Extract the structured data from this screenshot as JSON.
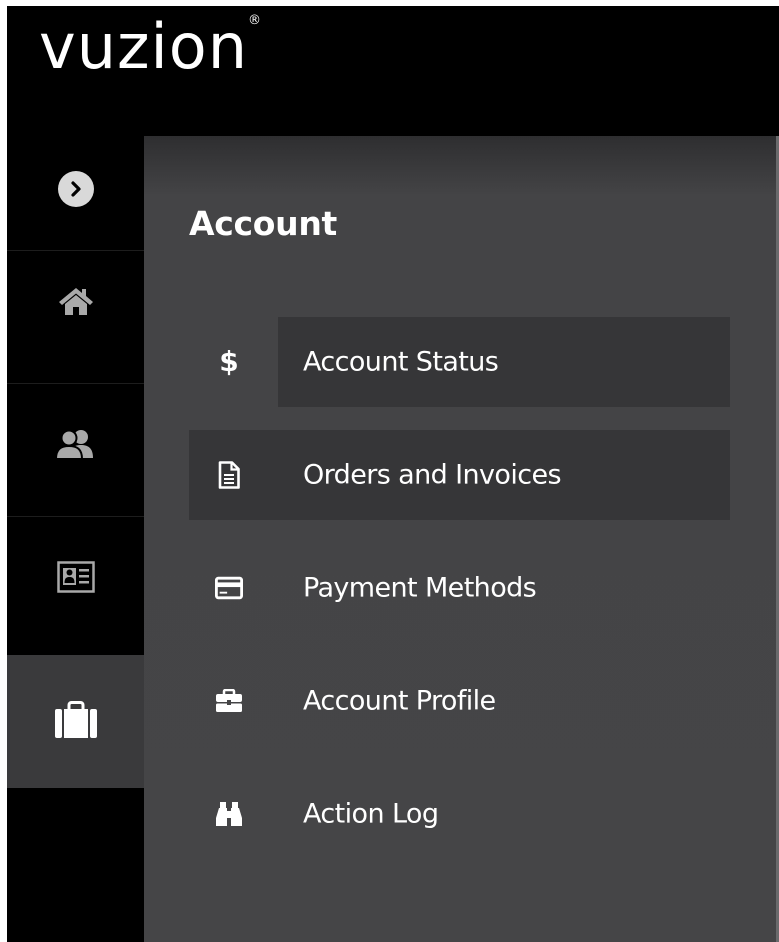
{
  "brand": {
    "name": "vuzion",
    "registered_mark": "®"
  },
  "rail": {
    "items": [
      {
        "name": "expand",
        "icon": "chevron-right-icon"
      },
      {
        "name": "home",
        "icon": "home-icon"
      },
      {
        "name": "users",
        "icon": "users-icon"
      },
      {
        "name": "contacts",
        "icon": "id-card-icon"
      },
      {
        "name": "account",
        "icon": "briefcase-icon",
        "active": true
      }
    ]
  },
  "panel": {
    "title": "Account",
    "menu": [
      {
        "label": "Account Status",
        "icon": "dollar-icon",
        "highlight": "partial"
      },
      {
        "label": "Orders and Invoices",
        "icon": "document-icon",
        "highlight": "full"
      },
      {
        "label": "Payment Methods",
        "icon": "credit-card-icon"
      },
      {
        "label": "Account Profile",
        "icon": "briefcase-icon"
      },
      {
        "label": "Action Log",
        "icon": "binoculars-icon"
      }
    ]
  },
  "colors": {
    "background": "#000000",
    "panel": "#454547",
    "active_rail": "#3a3a3c",
    "highlight": "#363638",
    "text": "#ffffff"
  }
}
